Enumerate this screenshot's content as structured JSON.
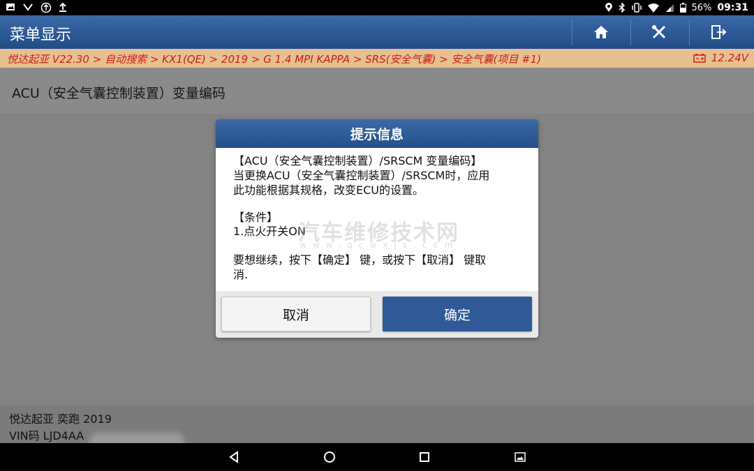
{
  "status_bar": {
    "left_icons": [
      "image-icon",
      "voicemail-icon",
      "usb-icon",
      "upload-icon"
    ],
    "right_icons": [
      "location-icon",
      "bluetooth-icon",
      "vibrate-icon",
      "wifi-icon",
      "signal-icon",
      "battery-icon"
    ],
    "battery": "56%",
    "time": "09:31"
  },
  "topbar": {
    "title": "菜单显示",
    "buttons": [
      "home-icon",
      "wrench-icon",
      "exit-icon"
    ]
  },
  "breadcrumb": {
    "path": "悦达起亚 V22.30 > 自动搜索 > KX1(QE) > 2019 > G 1.4 MPI KAPPA > SRS(安全气囊) > 安全气囊(项目 #1)",
    "voltage": "12.24V"
  },
  "page": {
    "title": "ACU（安全气囊控制装置）变量编码"
  },
  "dialog": {
    "title": "提示信息",
    "lines": [
      "【ACU（安全气囊控制装置）/SRSCM 变量编码】",
      " 当更换ACU（安全气囊控制装置）/SRSCM时，应用",
      "此功能根据其规格，改变ECU的设置。",
      "【条件】",
      "1.点火开关ON",
      "要想继续，按下【确定】 键，或按下【取消】 键取",
      "消."
    ],
    "watermark": "汽车维修技术网",
    "watermark_url": "www.qcwxjs.com",
    "cancel_label": "取消",
    "ok_label": "确定"
  },
  "vehicle_info": {
    "model": "悦达起亚 奕跑 2019",
    "vin": "VIN码 LJD4AA"
  },
  "colors": {
    "accent_blue": "#2f5a97",
    "breadcrumb_bg": "#e7c08f",
    "breadcrumb_text": "#c8201a"
  }
}
